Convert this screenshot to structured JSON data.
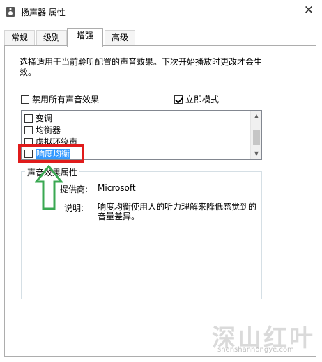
{
  "window": {
    "title": "扬声器 属性",
    "close_glyph": "✕"
  },
  "tabs": [
    {
      "label": "常规"
    },
    {
      "label": "级别"
    },
    {
      "label": "增强",
      "active": true
    },
    {
      "label": "高级"
    }
  ],
  "enhancement": {
    "description": "选择适用于当前聆听配置的声音效果。下次开始播放时更改才会生效。",
    "disable_all": {
      "label": "禁用所有声音效果",
      "checked": false
    },
    "immediate_mode": {
      "label": "立即模式",
      "checked": true
    },
    "effects": [
      {
        "label": "变调",
        "checked": false
      },
      {
        "label": "均衡器",
        "checked": false
      },
      {
        "label": "虚拟环绕声",
        "checked": false
      },
      {
        "label": "响度均衡",
        "checked": false,
        "selected": true
      }
    ]
  },
  "properties": {
    "group_title": "声音效果属性",
    "provider_label": "提供商:",
    "provider_value": "Microsoft",
    "description_label": "说明:",
    "description_value_line1": "响度均衡使用人的听力理解来降低感觉到的",
    "description_value_line2": "音量差异。"
  },
  "annotations": {
    "highlight_color": "#e01b1b",
    "arrow_color": "#3aa852"
  },
  "watermark": {
    "text": "深山红叶",
    "url": "shenshanhongye.com"
  },
  "colors": {
    "selection": "#3399ff",
    "border": "#adadad"
  }
}
